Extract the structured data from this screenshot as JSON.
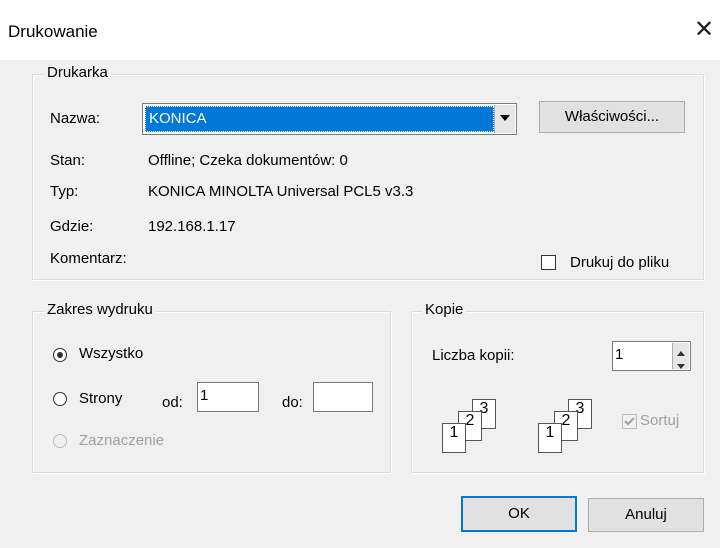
{
  "window": {
    "title": "Drukowanie",
    "close_symbol": "✕"
  },
  "printer": {
    "group_label": "Drukarka",
    "name_label": "Nazwa:",
    "name_value": "KONICA",
    "properties_button": "Właściwości...",
    "status_label": "Stan:",
    "status_value": "Offline; Czeka dokumentów: 0",
    "type_label": "Typ:",
    "type_value": "KONICA MINOLTA Universal PCL5 v3.3",
    "where_label": "Gdzie:",
    "where_value": "192.168.1.17",
    "comment_label": "Komentarz:",
    "print_to_file_label": "Drukuj do pliku",
    "print_to_file_checked": false
  },
  "range": {
    "group_label": "Zakres wydruku",
    "all_label": "Wszystko",
    "pages_label": "Strony",
    "from_label": "od:",
    "from_value": "1",
    "to_label": "do:",
    "to_value": "",
    "selection_label": "Zaznaczenie",
    "selected_option": "all"
  },
  "copies": {
    "group_label": "Kopie",
    "count_label": "Liczba kopii:",
    "count_value": "1",
    "collate_label": "Sortuj",
    "collate_checked": true,
    "collate_enabled": false,
    "page_numbers": [
      "1",
      "2",
      "3"
    ]
  },
  "buttons": {
    "ok": "OK",
    "cancel": "Anuluj"
  }
}
